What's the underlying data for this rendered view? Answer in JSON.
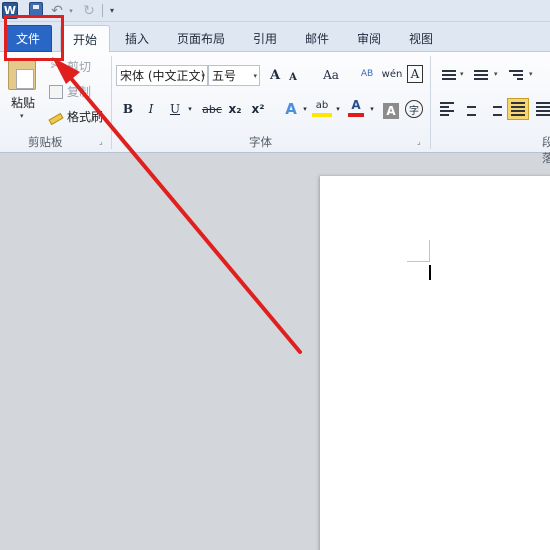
{
  "qat": {
    "app_letter": "W",
    "undo": "↶",
    "redo": "↻",
    "dropdown": "▾",
    "customize": "▾"
  },
  "tabs": [
    {
      "label": "文件"
    },
    {
      "label": "开始"
    },
    {
      "label": "插入"
    },
    {
      "label": "页面布局"
    },
    {
      "label": "引用"
    },
    {
      "label": "邮件"
    },
    {
      "label": "审阅"
    },
    {
      "label": "视图"
    }
  ],
  "clipboard": {
    "paste": "粘贴",
    "cut": "剪切",
    "copy": "复制",
    "format_painter": "格式刷",
    "group_label": "剪贴板"
  },
  "font": {
    "name": "宋体 (中文正文)",
    "size": "五号",
    "grow": "A",
    "shrink": "A",
    "case": "Aa",
    "clear": "AB",
    "pinyin": "wén",
    "char_border": "A",
    "bold": "B",
    "italic": "I",
    "underline": "U",
    "strike": "abc",
    "subscript": "x₂",
    "superscript": "x²",
    "effect": "A",
    "highlight": "ab",
    "font_color": "A",
    "shading": "A",
    "encircle": "字",
    "group_label": "字体"
  },
  "paragraph": {
    "group_label": "段落"
  },
  "colors": {
    "file_tab": "#2a66c5",
    "annotation": "#e0201f",
    "highlight_yellow": "#ffe600",
    "font_red": "#e01b1b"
  }
}
